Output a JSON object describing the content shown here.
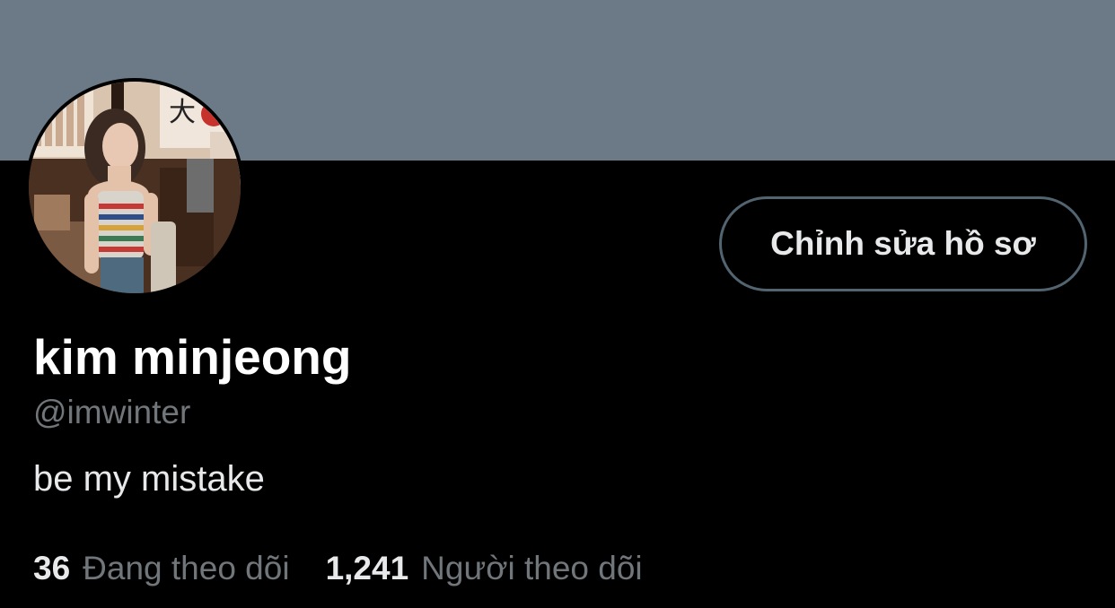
{
  "profile": {
    "banner_color": "#6b7a86",
    "avatar_description": "profile photo",
    "edit_button_label": "Chỉnh sửa hồ sơ",
    "display_name": "kim minjeong",
    "handle": "@imwinter",
    "bio": "be my mistake",
    "following": {
      "count": "36",
      "label": "Đang theo dõi"
    },
    "followers": {
      "count": "1,241",
      "label": "Người theo dõi"
    }
  },
  "colors": {
    "background": "#000000",
    "primary_text": "#e7e9ea",
    "secondary_text": "#71767b",
    "button_border": "#536471"
  }
}
